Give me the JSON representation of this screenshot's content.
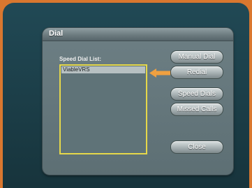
{
  "dialog": {
    "title": "Dial",
    "list_label": "Speed Dial List:",
    "list_items": [
      "ViableVRS"
    ]
  },
  "buttons": {
    "manual_dial": "Manual Dial",
    "redial": "Redial",
    "speed_dials": "Speed Dials",
    "missed_calls": "Missed Calls",
    "close": "Close"
  },
  "colors": {
    "outer_border": "#d9772f",
    "highlight_box": "#e6d84a",
    "arrow": "#f0a040"
  },
  "icons": {
    "arrow": "arrow-left-icon"
  }
}
